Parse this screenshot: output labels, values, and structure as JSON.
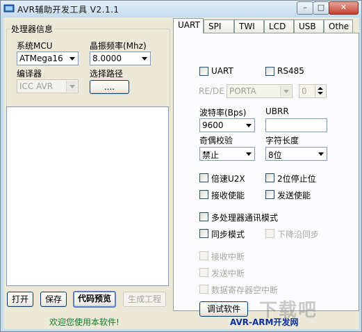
{
  "window": {
    "title": "AVR辅助开发工具 V2.1.1",
    "min": "–",
    "max": "□",
    "close": "✕"
  },
  "left": {
    "group_title": "处理器信息",
    "mcu_label": "系统MCU",
    "mcu_value": "ATMega16",
    "freq_label": "晶振频率(Mhz)",
    "freq_value": "8.0000",
    "compiler_label": "编译器",
    "compiler_value": "ICC AVR",
    "path_label": "选择路径",
    "path_button": "....",
    "buttons": {
      "open": "打开",
      "save": "保存",
      "preview": "代码预览",
      "generate": "生成工程"
    }
  },
  "tabs": [
    "UART",
    "SPI",
    "TWI",
    "LCD",
    "USB",
    "Othe"
  ],
  "uart": {
    "uart_chk": "UART",
    "rs485_chk": "RS485",
    "rede_label": "RE/DE",
    "rede_port": "PORTA",
    "rede_pin": "0",
    "baud_label": "波特率(Bps)",
    "baud_value": "9600",
    "ubrr_label": "UBRR",
    "ubrr_value": "",
    "parity_label": "奇偶校验",
    "parity_value": "禁止",
    "charlen_label": "字符长度",
    "charlen_value": "8位",
    "u2x": "倍速U2X",
    "stop2": "2位停止位",
    "rx_en": "接收使能",
    "tx_en": "发送使能",
    "multi": "多处理器通讯模式",
    "sync": "同步模式",
    "falling": "下降沿同步",
    "rx_int": "接收中断",
    "tx_int": "发送中断",
    "udre_int": "数据寄存器空中断",
    "debug_button": "调试软件"
  },
  "status": {
    "welcome": "欢迎您使用本软件!",
    "brand": "AVR-ARM开发网"
  },
  "watermark": "下载吧"
}
